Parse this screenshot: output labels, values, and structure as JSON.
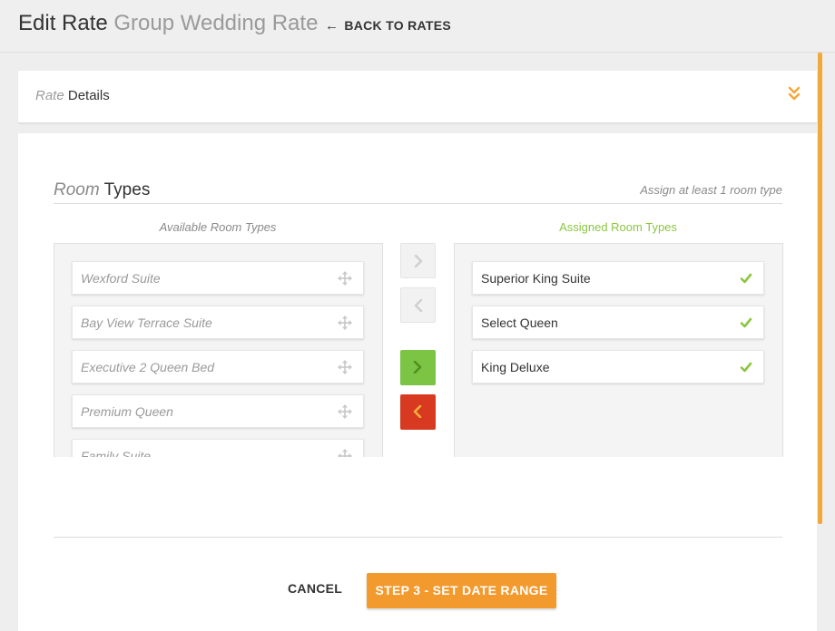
{
  "header": {
    "title": "Edit Rate",
    "subtitle": "Group Wedding Rate",
    "back_label": "BACK TO RATES"
  },
  "rate_details": {
    "title_light": "Rate",
    "title_strong": "Details"
  },
  "room_types": {
    "title_light": "Room",
    "title_strong": "Types",
    "hint": "Assign at least 1 room type",
    "available_heading": "Available Room Types",
    "assigned_heading": "Assigned Room Types",
    "available": [
      {
        "label": "Wexford Suite"
      },
      {
        "label": "Bay View Terrace Suite"
      },
      {
        "label": "Executive 2 Queen Bed"
      },
      {
        "label": "Premium Queen"
      },
      {
        "label": "Family Suite"
      }
    ],
    "assigned": [
      {
        "label": "Superior King Suite"
      },
      {
        "label": "Select Queen"
      },
      {
        "label": "King Deluxe"
      }
    ]
  },
  "footer": {
    "cancel_label": "CANCEL",
    "next_label": "STEP 3 - SET DATE RANGE"
  },
  "colors": {
    "accent_orange": "#f39a2e",
    "assigned_green": "#8cc63f",
    "add_green": "#7cc443",
    "remove_red": "#d83a21"
  }
}
